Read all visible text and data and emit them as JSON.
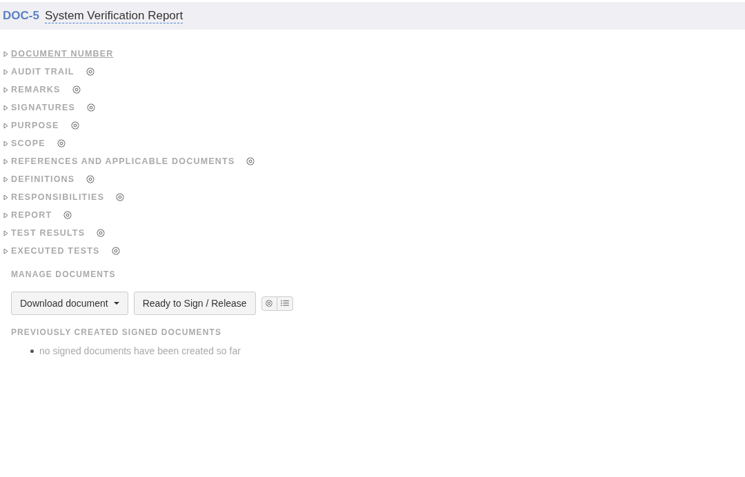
{
  "header": {
    "doc_id": "DOC-5",
    "title": "System Verification Report"
  },
  "sections": [
    {
      "label": "DOCUMENT NUMBER",
      "hovered": true,
      "settings": false
    },
    {
      "label": "AUDIT TRAIL",
      "hovered": false,
      "settings": true
    },
    {
      "label": "REMARKS",
      "hovered": false,
      "settings": true
    },
    {
      "label": "SIGNATURES",
      "hovered": false,
      "settings": true
    },
    {
      "label": "PURPOSE",
      "hovered": false,
      "settings": true
    },
    {
      "label": "SCOPE",
      "hovered": false,
      "settings": true
    },
    {
      "label": "REFERENCES AND APPLICABLE DOCUMENTS",
      "hovered": false,
      "settings": true
    },
    {
      "label": "DEFINITIONS",
      "hovered": false,
      "settings": true
    },
    {
      "label": "RESPONSIBILITIES",
      "hovered": false,
      "settings": true
    },
    {
      "label": "REPORT",
      "hovered": false,
      "settings": true
    },
    {
      "label": "TEST RESULTS",
      "hovered": false,
      "settings": true
    },
    {
      "label": "EXECUTED TESTS",
      "hovered": false,
      "settings": true
    }
  ],
  "manage": {
    "heading": "MANAGE DOCUMENTS",
    "download_button": "Download document",
    "release_button": "Ready to Sign / Release"
  },
  "previous": {
    "heading": "PREVIOUSLY CREATED SIGNED DOCUMENTS",
    "items": [
      "no signed documents have been created so far"
    ]
  }
}
